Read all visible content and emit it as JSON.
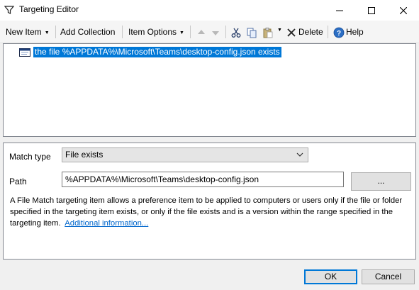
{
  "window": {
    "title": "Targeting Editor"
  },
  "toolbar": {
    "new_item": "New Item",
    "add_collection": "Add Collection",
    "item_options": "Item Options",
    "delete": "Delete",
    "help": "Help"
  },
  "tree": {
    "items": [
      {
        "label": "the file %APPDATA%\\Microsoft\\Teams\\desktop-config.json exists",
        "selected": true
      }
    ]
  },
  "props": {
    "match_type_label": "Match type",
    "match_type_value": "File exists",
    "path_label": "Path",
    "path_value": "%APPDATA%\\Microsoft\\Teams\\desktop-config.json",
    "browse_label": "...",
    "description": "A File Match targeting item allows a preference item to be applied to computers or users only if the file or folder specified in the targeting item exists, or only if the file exists and is a version within the range specified in the targeting item.",
    "more_info_link": "Additional information..."
  },
  "buttons": {
    "ok": "OK",
    "cancel": "Cancel"
  },
  "colors": {
    "selection": "#0078d7",
    "link": "#0066cc"
  }
}
